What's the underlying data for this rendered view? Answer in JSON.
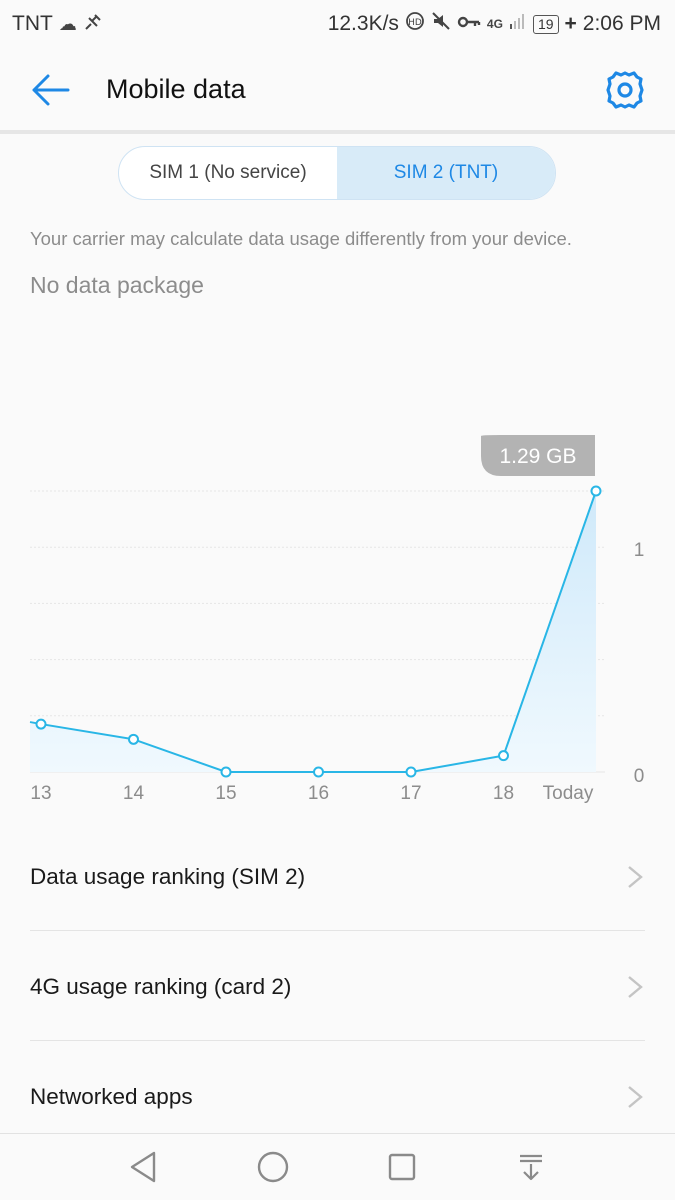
{
  "status_bar": {
    "carrier": "TNT",
    "speed": "12.3K/s",
    "network": "4G",
    "battery": "19",
    "time": "2:06 PM",
    "icons": [
      "cloud-icon",
      "satellite-icon",
      "hd-call-icon",
      "mute-icon",
      "vpn-key-icon",
      "signal-icon",
      "battery-icon"
    ]
  },
  "app_bar": {
    "title": "Mobile data",
    "icons": [
      "back-arrow-icon",
      "gear-icon"
    ]
  },
  "sim_tabs": [
    {
      "label": "SIM 1 (No service)",
      "selected": false
    },
    {
      "label": "SIM 2 (TNT)",
      "selected": true
    }
  ],
  "note": "Your carrier may calculate data usage differently from your device.",
  "package": "No data package",
  "chart_data": {
    "type": "area",
    "categories": [
      "13",
      "14",
      "15",
      "16",
      "17",
      "18",
      "Today"
    ],
    "values": [
      0.22,
      0.15,
      0.0,
      0.0,
      0.0,
      0.075,
      1.29
    ],
    "callout": "1.29 GB",
    "y_tick_labels": [
      "1",
      "0"
    ],
    "ylim": [
      0,
      1.29
    ],
    "grid": true,
    "colors": {
      "line": "#29b6e6",
      "fill": "#dff1fb",
      "grid": "#e6e6e6",
      "callout": "#b3b3b3"
    }
  },
  "list": [
    {
      "label": "Data usage ranking (SIM 2)"
    },
    {
      "label": "4G usage ranking (card 2)"
    },
    {
      "label": "Networked apps"
    }
  ],
  "nav": [
    "back-icon",
    "home-icon",
    "recents-icon",
    "notifications-pull-icon"
  ],
  "colors": {
    "accent": "#1e88e5",
    "background": "#fafafa"
  }
}
